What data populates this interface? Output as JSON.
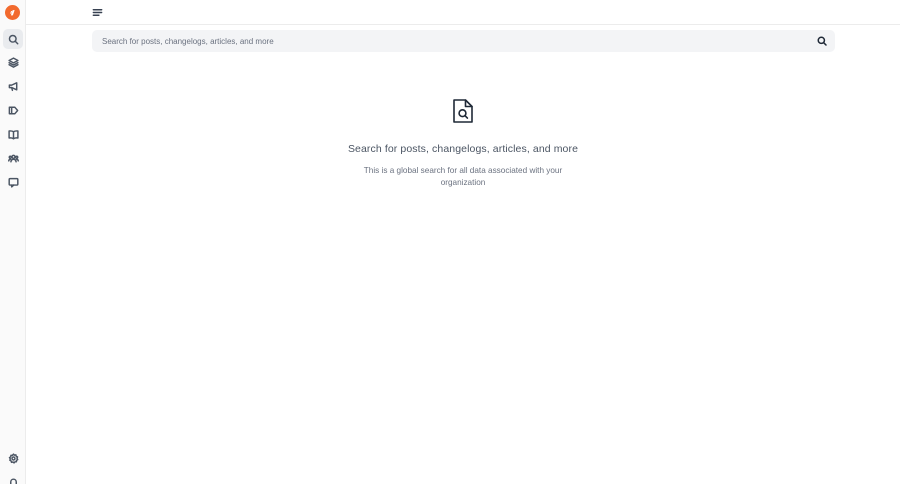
{
  "search": {
    "placeholder": "Search for posts, changelogs, articles, and more"
  },
  "empty_state": {
    "title": "Search for posts, changelogs, articles, and more",
    "description": "This is a global search for all data associated with your organization"
  },
  "sidebar": {
    "items": [
      {
        "icon": "search-icon",
        "active": true
      },
      {
        "icon": "layers-icon",
        "active": false
      },
      {
        "icon": "megaphone-icon",
        "active": false
      },
      {
        "icon": "tag-icon",
        "active": false
      },
      {
        "icon": "book-icon",
        "active": false
      },
      {
        "icon": "users-icon",
        "active": false
      },
      {
        "icon": "message-icon",
        "active": false
      }
    ],
    "bottom_items": [
      {
        "icon": "gear-icon"
      },
      {
        "icon": "bell-icon"
      }
    ]
  },
  "colors": {
    "brand": "#f26a2e",
    "active_bg": "#e9ebee",
    "search_bg": "#f3f4f6"
  }
}
